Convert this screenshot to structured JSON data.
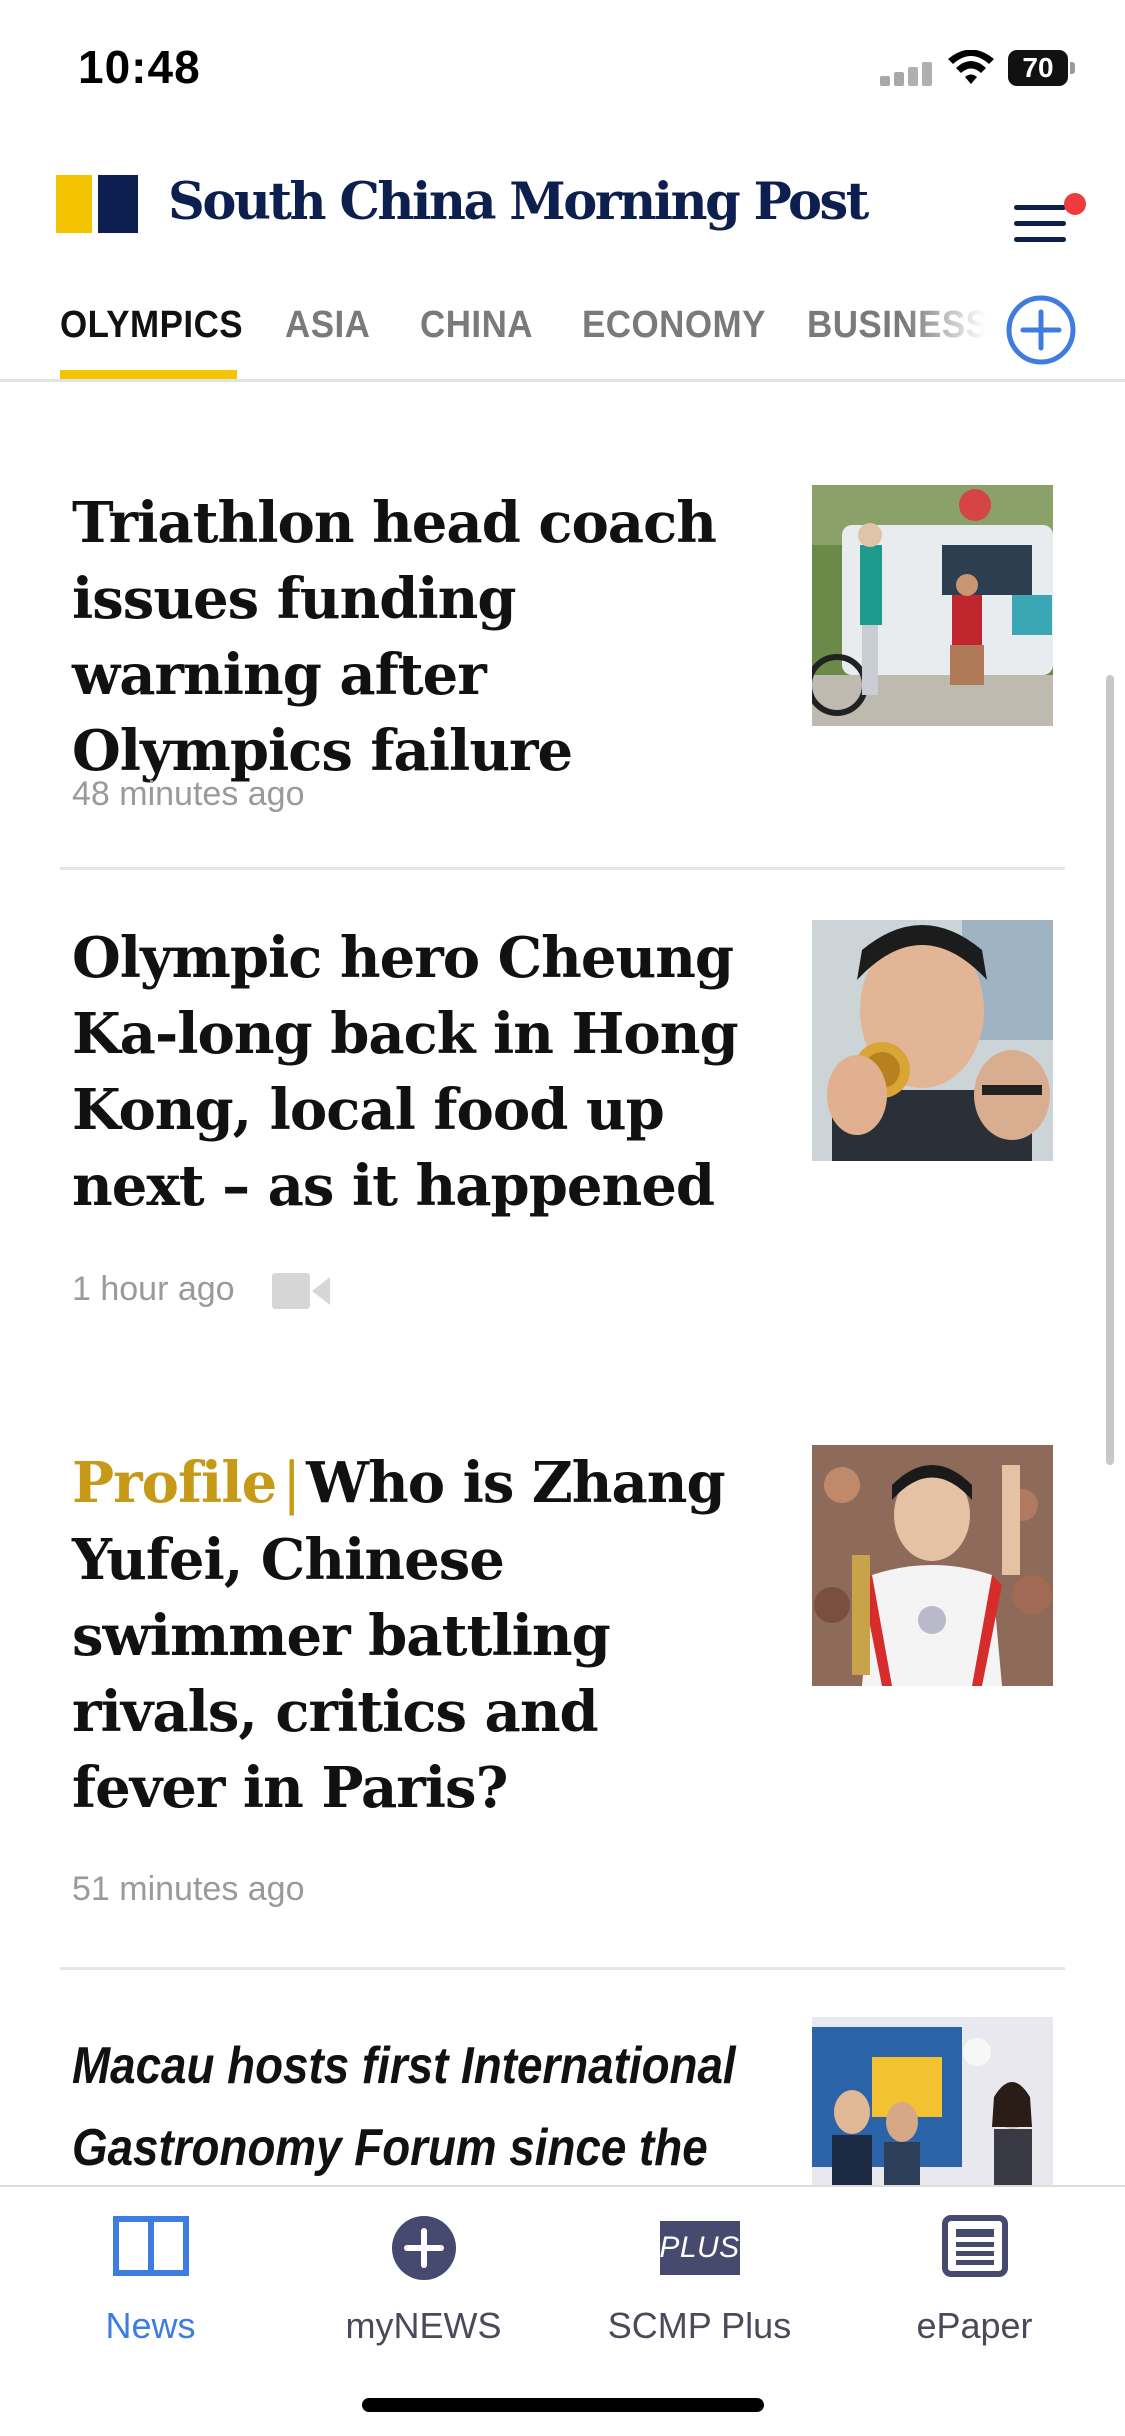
{
  "status_bar": {
    "time": "10:48",
    "battery": "70"
  },
  "header": {
    "brand_name": "South China Morning Post",
    "menu_icon": "hamburger-menu-icon",
    "notification_dot_color": "#ef3b3b"
  },
  "tabs": {
    "items": [
      {
        "label": "OLYMPICS",
        "active": true
      },
      {
        "label": "ASIA",
        "active": false
      },
      {
        "label": "CHINA",
        "active": false
      },
      {
        "label": "ECONOMY",
        "active": false
      },
      {
        "label": "BUSINESS",
        "active": false
      }
    ],
    "add_icon": "plus-circle-icon",
    "accent_color": "#f5c400"
  },
  "articles": [
    {
      "headline": "Triathlon head coach issues funding warning after Olympics failure",
      "time": "48 minutes ago",
      "thumbnail": "triathlon-athletes-photo"
    },
    {
      "headline": "Olympic hero Cheung Ka-long back in Hong Kong, local food up next – as it happened",
      "time": "1 hour ago",
      "has_video": true,
      "thumbnail": "fencer-with-gold-medal-photo"
    },
    {
      "label": "Profile",
      "separator": "|",
      "headline": "Who is Zhang Yufei, Chinese swimmer battling rivals, critics and fever in Paris?",
      "time": "51 minutes ago",
      "thumbnail": "swimmer-with-medal-photo"
    },
    {
      "headline_line1": "Macau hosts first International",
      "headline_line2": "Gastronomy Forum since the",
      "thumbnail": "gastronomy-forum-photo"
    }
  ],
  "bottom_nav": {
    "items": [
      {
        "label": "News",
        "icon": "book-icon",
        "active": true
      },
      {
        "label": "myNEWS",
        "icon": "plus-circle-icon",
        "active": false
      },
      {
        "label": "SCMP Plus",
        "icon": "plus-badge-icon",
        "badge_text": "PLUS",
        "active": false
      },
      {
        "label": "ePaper",
        "icon": "newspaper-icon",
        "active": false
      }
    ],
    "active_color": "#3f7ce0"
  }
}
